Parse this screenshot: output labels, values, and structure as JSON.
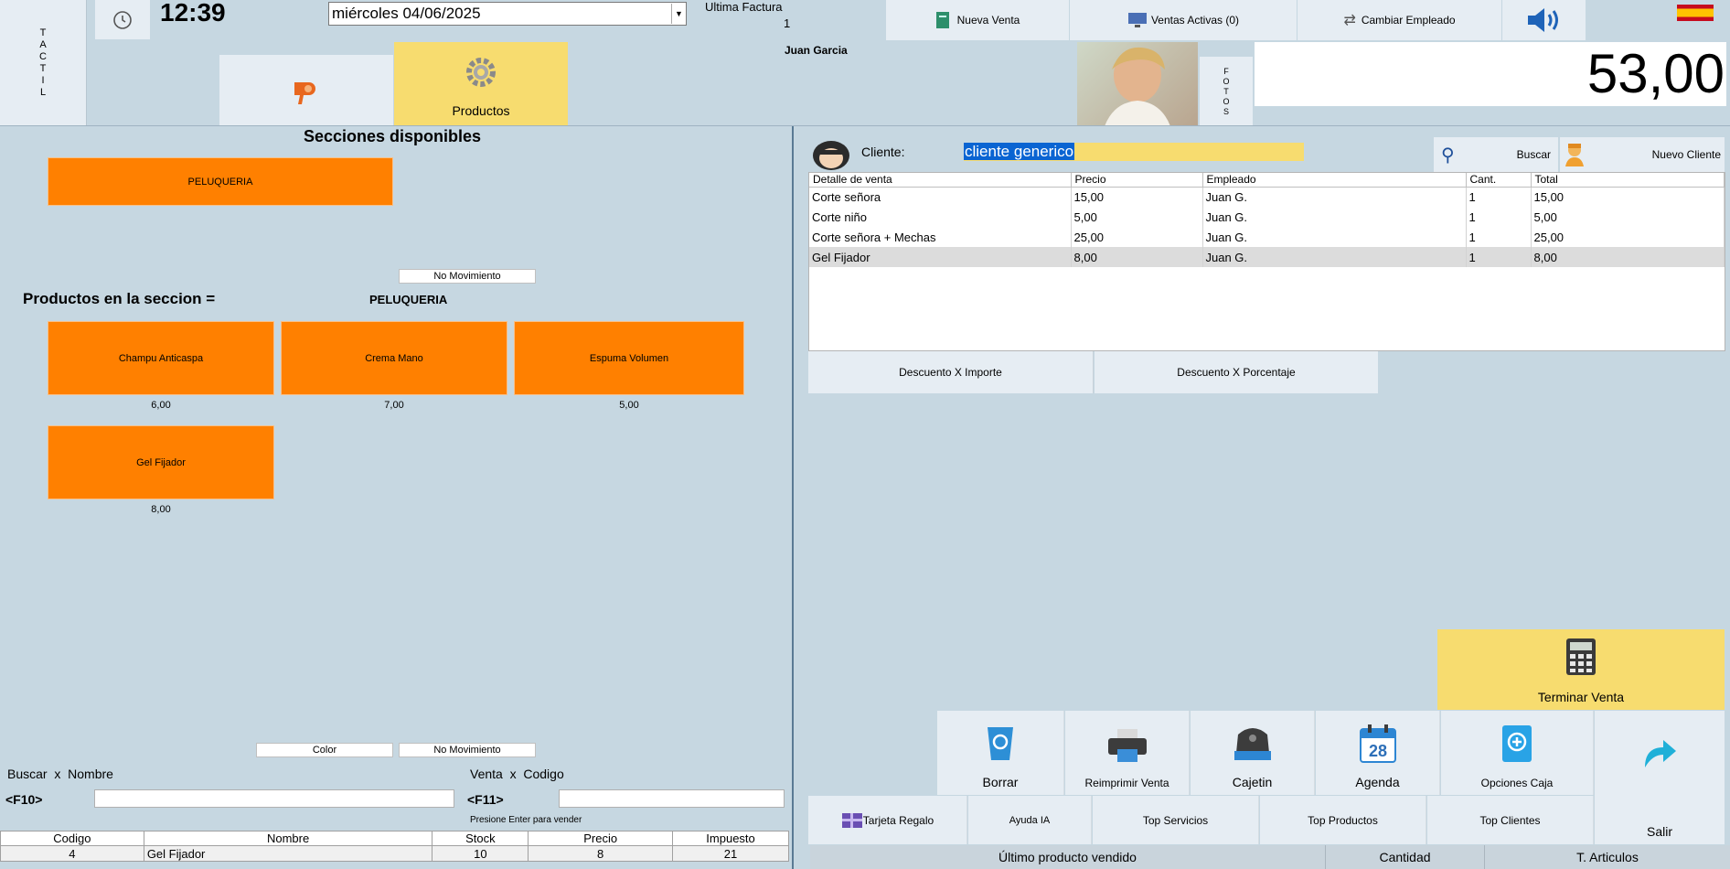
{
  "header": {
    "tactil_label": "TACTIL",
    "time": "12:39",
    "date": "miércoles 04/06/2025",
    "ultima_factura_label": "Ultima Factura",
    "ultima_factura_value": "1",
    "employee_name": "Juan Garcia",
    "products_tab_label": "Productos",
    "fotos_label": "FOTOS",
    "total": "53,00"
  },
  "topbar": {
    "nueva_venta": "Nueva Venta",
    "ventas_activas": "Ventas Activas (0)",
    "cambiar_empleado": "Cambiar Empleado"
  },
  "left": {
    "secciones_title": "Secciones disponibles",
    "sections": [
      "PELUQUERIA"
    ],
    "no_movimiento_1": "No Movimiento",
    "productos_label": "Productos en la seccion =",
    "current_section": "PELUQUERIA",
    "products": [
      {
        "name": "Champu Anticaspa",
        "price": "6,00"
      },
      {
        "name": "Crema Mano",
        "price": "7,00"
      },
      {
        "name": "Espuma Volumen",
        "price": "5,00"
      },
      {
        "name": "Gel Fijador",
        "price": "8,00"
      }
    ],
    "color_label": "Color",
    "no_movimiento_2": "No Movimiento",
    "buscar_nombre": "Buscar  x  Nombre",
    "f10": "<F10>",
    "venta_codigo": "Venta  x  Codigo",
    "f11": "<F11>",
    "presione_enter": "Presione Enter para vender",
    "product_table": {
      "headers": [
        "Codigo",
        "Nombre",
        "Stock",
        "Precio",
        "Impuesto"
      ],
      "rows": [
        [
          "4",
          "Gel Fijador",
          "10",
          "8",
          "21"
        ]
      ]
    }
  },
  "right": {
    "cliente_label": "Cliente:",
    "cliente_value": "cliente generico",
    "buscar": "Buscar",
    "nuevo_cliente": "Nuevo Cliente",
    "sale_table": {
      "headers": [
        "Detalle de venta",
        "Precio",
        "Empleado",
        "Cant.",
        "Total"
      ],
      "rows": [
        [
          "Corte señora",
          "15,00",
          "Juan G.",
          "1",
          "15,00"
        ],
        [
          "Corte niño",
          "5,00",
          "Juan G.",
          "1",
          "5,00"
        ],
        [
          "Corte señora + Mechas",
          "25,00",
          "Juan G.",
          "1",
          "25,00"
        ],
        [
          "Gel Fijador",
          "8,00",
          "Juan G.",
          "1",
          "8,00"
        ]
      ]
    },
    "descuento_importe": "Descuento X Importe",
    "descuento_porcentaje": "Descuento X Porcentaje",
    "terminar_venta": "Terminar Venta",
    "tools": {
      "borrar": "Borrar",
      "reimprimir": "Reimprimir Venta",
      "cajetin": "Cajetin",
      "agenda": "Agenda",
      "agenda_day": "28",
      "opciones_caja": "Opciones Caja",
      "salir": "Salir"
    },
    "bottom_buttons": {
      "tarjeta_regalo": "Tarjeta Regalo",
      "ayuda_ia": "Ayuda IA",
      "top_servicios": "Top Servicios",
      "top_productos": "Top Productos",
      "top_clientes": "Top Clientes"
    },
    "status": {
      "ultimo_producto": "Último producto vendido",
      "cantidad": "Cantidad",
      "t_articulos": "T. Articulos"
    }
  },
  "colors": {
    "background": "#c6d7e1",
    "orange": "#ff8000",
    "yellow": "#f7dc6f",
    "selection": "#0a64d2"
  }
}
